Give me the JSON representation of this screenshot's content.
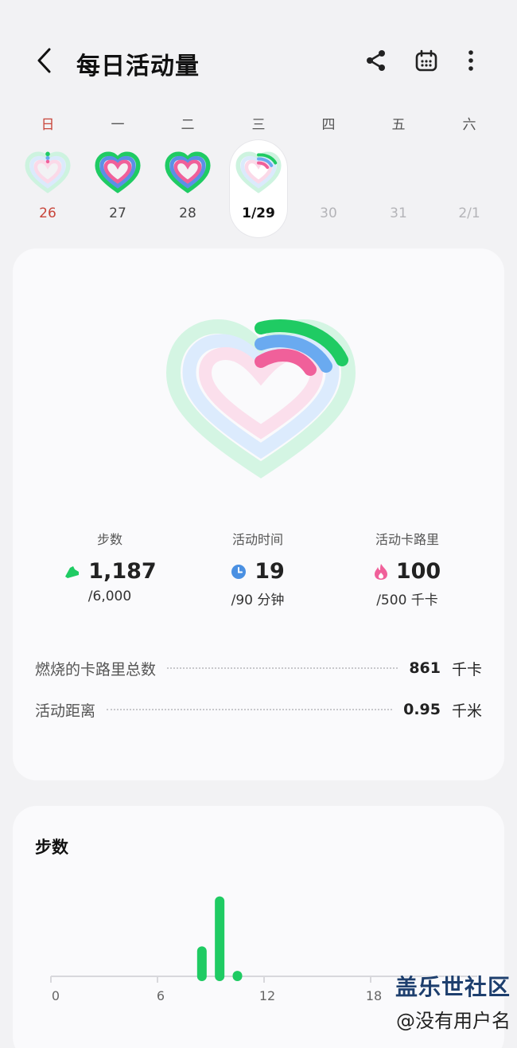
{
  "header": {
    "title": "每日活动量",
    "back_icon": "back-chevron-icon",
    "share_icon": "share-icon",
    "calendar_icon": "calendar-icon",
    "more_icon": "more-vertical-icon"
  },
  "week": {
    "days": [
      {
        "label": "日",
        "date": "26"
      },
      {
        "label": "一",
        "date": "27"
      },
      {
        "label": "二",
        "date": "28"
      },
      {
        "label": "三",
        "date": "1/29"
      },
      {
        "label": "四",
        "date": "30"
      },
      {
        "label": "五",
        "date": "31"
      },
      {
        "label": "六",
        "date": "2/1"
      }
    ]
  },
  "summary": {
    "stats": [
      {
        "label": "步数",
        "value": "1,187",
        "goal": "/6,000",
        "icon": "shoe-icon",
        "color": "#1fcb63"
      },
      {
        "label": "活动时间",
        "value": "19",
        "goal": "/90 分钟",
        "icon": "clock-icon",
        "color": "#4a90e2"
      },
      {
        "label": "活动卡路里",
        "value": "100",
        "goal": "/500 千卡",
        "icon": "flame-icon",
        "color": "#f0609a"
      }
    ],
    "rows": [
      {
        "label": "燃烧的卡路里总数",
        "value": "861",
        "unit": "千卡"
      },
      {
        "label": "活动距离",
        "value": "0.95",
        "unit": "千米"
      }
    ],
    "progress": {
      "steps": 0.198,
      "active_time": 0.211,
      "calories": 0.2
    },
    "colors": {
      "steps": "#1fcb63",
      "active_time": "#6aaaf0",
      "calories": "#f0609a"
    }
  },
  "steps_card": {
    "title": "步数",
    "x_ticks": [
      "0",
      "6",
      "12",
      "18"
    ]
  },
  "chart_data": {
    "type": "bar",
    "title": "步数",
    "xlabel": "",
    "ylabel": "",
    "x_ticks": [
      "0",
      "6",
      "12",
      "18"
    ],
    "x": [
      8,
      9,
      10
    ],
    "values": [
      330,
      880,
      60
    ],
    "xlim": [
      0,
      24
    ],
    "ylim": [
      0,
      1000
    ],
    "grid": false,
    "bar_color": "#1fcb63"
  },
  "watermark": {
    "brand": "盖乐世社区",
    "user": "@没有用户名"
  }
}
